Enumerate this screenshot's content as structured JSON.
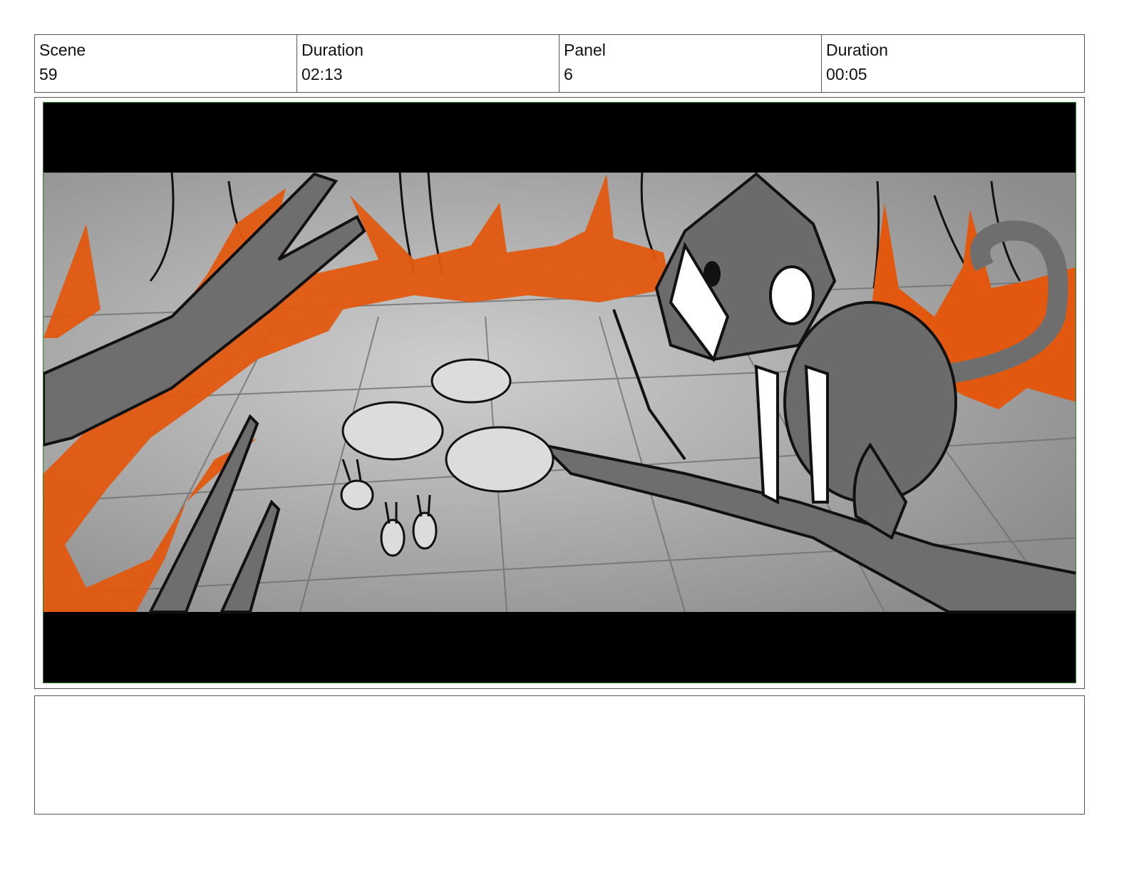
{
  "header": {
    "scene_label": "Scene",
    "scene_value": "59",
    "scene_duration_label": "Duration",
    "scene_duration_value": "02:13",
    "panel_label": "Panel",
    "panel_value": "6",
    "panel_duration_label": "Duration",
    "panel_duration_value": "00:05"
  },
  "panel": {
    "letterbox_color": "#000000",
    "fire_color": "#e2580e",
    "ground_color": "#9a9a9a"
  },
  "notes": {
    "text": ""
  }
}
